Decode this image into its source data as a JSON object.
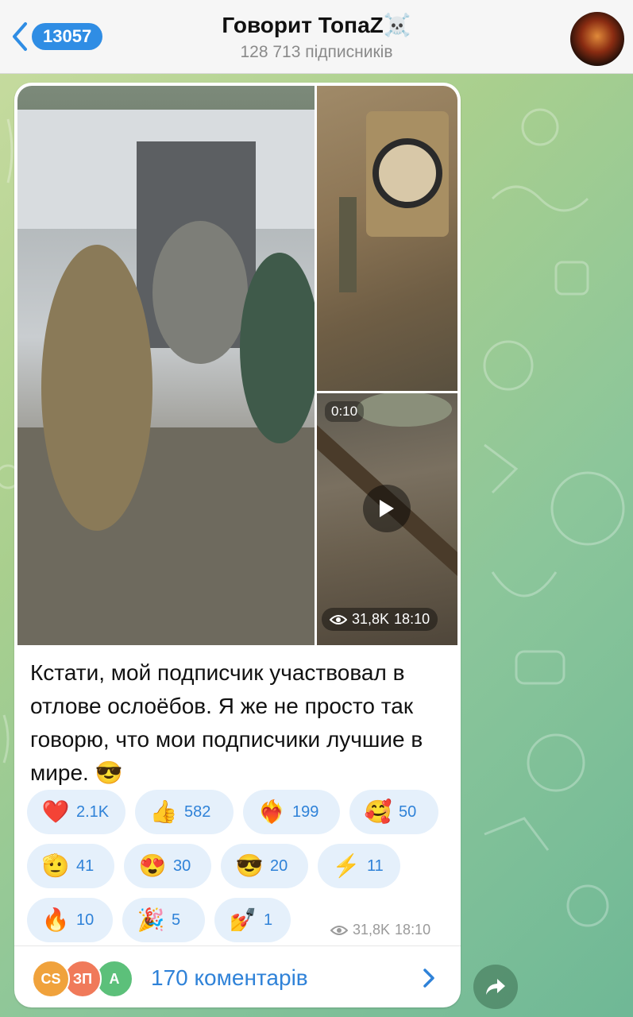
{
  "header": {
    "back_count": "13057",
    "title": "Говорит ТопаZ☠️",
    "subtitle": "128 713 підписників"
  },
  "post": {
    "video_duration": "0:10",
    "media_views": "31,8K",
    "media_time": "18:10",
    "text": "Кстати, мой подписчик участвовал в отлове ослоёбов. Я же не просто так говорю, что мои подписчики лучшие в мире. 😎",
    "views": "31,8K",
    "time": "18:10"
  },
  "reactions": [
    {
      "emoji": "❤️",
      "count": "2.1K"
    },
    {
      "emoji": "👍",
      "count": "582"
    },
    {
      "emoji": "❤️‍🔥",
      "count": "199"
    },
    {
      "emoji": "🥰",
      "count": "50"
    },
    {
      "emoji": "🫡",
      "count": "41"
    },
    {
      "emoji": "😍",
      "count": "30"
    },
    {
      "emoji": "😎",
      "count": "20"
    },
    {
      "emoji": "⚡",
      "count": "11"
    },
    {
      "emoji": "🔥",
      "count": "10"
    },
    {
      "emoji": "🎉",
      "count": "5"
    },
    {
      "emoji": "💅",
      "count": "1"
    }
  ],
  "comments": {
    "label": "170 коментарів",
    "avatars": [
      {
        "initials": "CS",
        "color": "#f0a23c"
      },
      {
        "initials": "ЗП",
        "color": "#f07a5a"
      },
      {
        "initials": "A",
        "color": "#5cc07a"
      }
    ]
  },
  "colors": {
    "accent": "#2f82d8",
    "badge": "#2f8de4",
    "pill_bg": "#e5f0fb"
  },
  "icons": {
    "back": "chevron-left-icon",
    "views": "eye-icon",
    "play": "play-icon",
    "comments_arrow": "chevron-right-icon",
    "share": "share-arrow-icon"
  }
}
